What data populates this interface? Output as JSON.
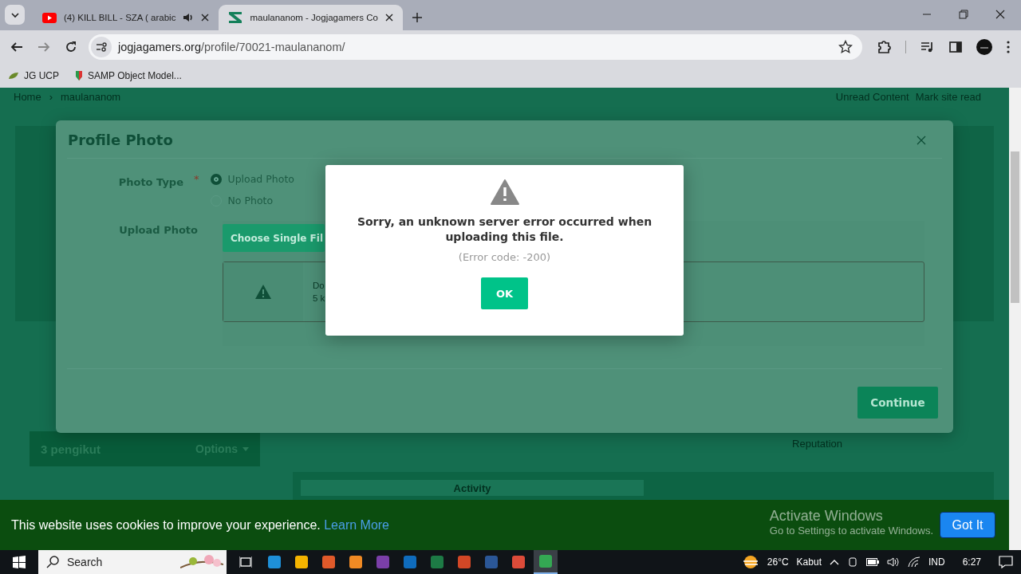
{
  "browser": {
    "tabs": [
      {
        "title": "(4) KILL BILL - SZA ( arabic",
        "selected": false,
        "audio": true,
        "kind": "video"
      },
      {
        "title": "maulananom - Jogjagamers Co",
        "selected": true,
        "audio": false,
        "kind": "site"
      }
    ],
    "url_host": "jogjagamers.org",
    "url_path": "/profile/70021-maulananom/",
    "bookmarks": [
      {
        "label": "JG UCP",
        "kind": "jg"
      },
      {
        "label": "SAMP Object Model...",
        "kind": "samp"
      }
    ]
  },
  "page": {
    "breadcrumb": [
      "Home",
      "maulananom"
    ],
    "breadcrumb_separator": "›",
    "header_links": [
      "Unread Content",
      "Mark site read"
    ],
    "followers": "3 pengikut",
    "options": "Options",
    "stat_label": "Reputation",
    "activity_tab": "Activity"
  },
  "modal": {
    "title": "Profile Photo",
    "photo_type_label": "Photo Type",
    "required_mark": "*",
    "options": [
      {
        "label": "Upload Photo",
        "selected": true
      },
      {
        "label": "No Photo",
        "selected": false
      }
    ],
    "upload_label": "Upload Photo",
    "choose_button": "Choose Single Fil",
    "file_name": "Do",
    "file_size": "5 k",
    "continue_button": "Continue"
  },
  "alert": {
    "message": "Sorry, an unknown server error occurred when uploading this file.",
    "code": "(Error code: -200)",
    "button": "OK"
  },
  "cookie_bar": {
    "text": "This website uses cookies to improve your experience.",
    "link": "Learn More",
    "button": "Got It"
  },
  "watermark": {
    "title": "Activate Windows",
    "subtitle": "Go to Settings to activate Windows."
  },
  "taskbar": {
    "search": "Search",
    "apps": [
      {
        "color": "#1e90d8",
        "selected": false
      },
      {
        "color": "#f4b400",
        "selected": false
      },
      {
        "color": "#e05a2a",
        "selected": false
      },
      {
        "color": "#f08a24",
        "selected": false
      },
      {
        "color": "#7b3fa8",
        "selected": false
      },
      {
        "color": "#0f6cbd",
        "selected": false
      },
      {
        "color": "#1d7a45",
        "selected": false
      },
      {
        "color": "#d24726",
        "selected": false
      },
      {
        "color": "#2b5797",
        "selected": false
      },
      {
        "color": "#dd4b39",
        "selected": false
      },
      {
        "color": "#34a853",
        "selected": true
      }
    ],
    "temperature": "26°C",
    "condition": "Kabut",
    "language": "IND",
    "time": "6:27"
  }
}
